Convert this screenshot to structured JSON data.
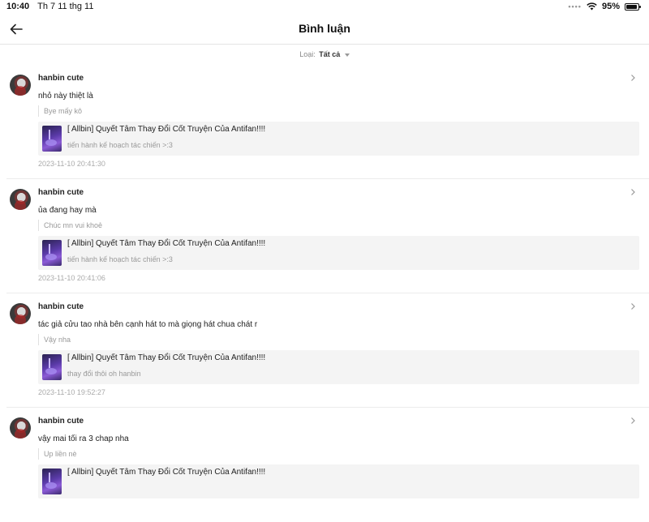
{
  "status_bar": {
    "time": "10:40",
    "date": "Th 7 11 thg 11",
    "battery": "95%",
    "battery_level": 0.95
  },
  "nav": {
    "title": "Bình luận",
    "back_icon": "arrow-left-icon"
  },
  "filter": {
    "label": "Loại:",
    "value": "Tất cả"
  },
  "comments": [
    {
      "user": "hanbin cute",
      "text": "nhỏ này thiệt là",
      "reply_to": "Bye mấy kô",
      "story_title": "[ Allbin] Quyết Tâm Thay Đổi Cốt Truyện Của Antifan!!!!",
      "story_subtitle": "tiến hành kế hoạch tác chiến >:3",
      "timestamp": "2023-11-10 20:41:30"
    },
    {
      "user": "hanbin cute",
      "text": "ủa đang hay mà",
      "reply_to": "Chúc mn vui khoẻ",
      "story_title": "[ Allbin] Quyết Tâm Thay Đổi Cốt Truyện Của Antifan!!!!",
      "story_subtitle": "tiến hành kế hoạch tác chiến >:3",
      "timestamp": "2023-11-10 20:41:06"
    },
    {
      "user": "hanbin cute",
      "text": "tác giả cửu tao nhà bên cạnh hát to mà giọng hát chua chát  r",
      "reply_to": "Vậy nha",
      "story_title": "[ Allbin] Quyết Tâm Thay Đổi Cốt Truyện Của Antifan!!!!",
      "story_subtitle": "thay đổi thôi oh hanbin",
      "timestamp": "2023-11-10 19:52:27"
    },
    {
      "user": "hanbin cute",
      "text": "vậy mai tối ra 3 chap nha",
      "reply_to": "Up liền nè",
      "story_title": "[ Allbin] Quyết Tâm Thay Đổi Cốt Truyện Của Antifan!!!!",
      "story_subtitle": "",
      "timestamp": ""
    }
  ]
}
